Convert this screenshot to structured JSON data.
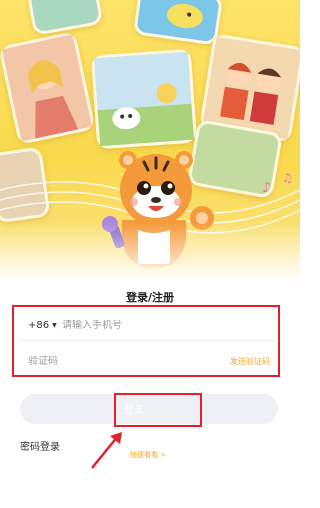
{
  "form": {
    "title": "登录/注册",
    "country_code": "+86",
    "phone_placeholder": "请输入手机号",
    "code_placeholder": "验证码",
    "send_code_label": "发送验证码",
    "login_label": "登录",
    "password_login_label": "密码登录",
    "browse_label": "随便看看 >"
  },
  "colors": {
    "accent": "#f5a623",
    "highlight": "#e5202d",
    "hero_bg": "#f9d94c",
    "login_button_bg": "#eef0f6"
  }
}
